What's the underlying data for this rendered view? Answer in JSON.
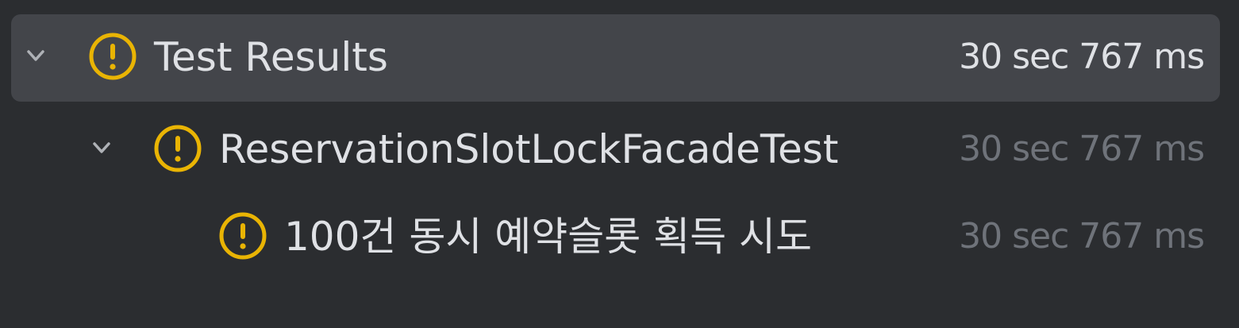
{
  "colors": {
    "background": "#2b2d30",
    "selected_row": "#43454a",
    "warning": "#e9b404",
    "text": "#dfe1e5",
    "muted_text": "#6f737a"
  },
  "tree": {
    "root": {
      "label": "Test Results",
      "duration": "30 sec 767 ms",
      "status_icon": "warning-circle-icon",
      "expanded": true,
      "selected": true
    },
    "suite": {
      "label": "ReservationSlotLockFacadeTest",
      "duration": "30 sec 767 ms",
      "status_icon": "warning-circle-icon",
      "expanded": true
    },
    "test": {
      "label": "100건 동시 예약슬롯 획득 시도",
      "duration": "30 sec 767 ms",
      "status_icon": "warning-circle-icon"
    }
  }
}
